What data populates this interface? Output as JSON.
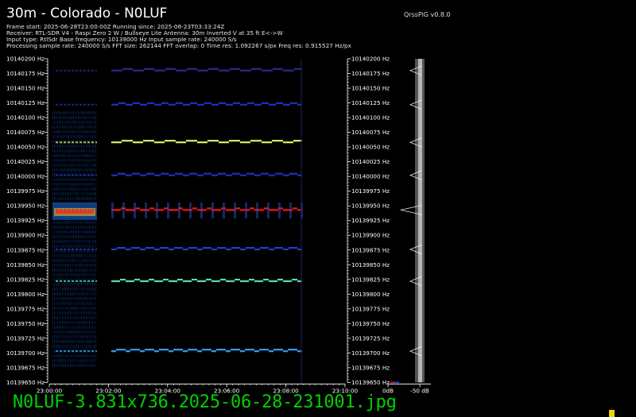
{
  "header": {
    "title": "30m - Colorado - N0LUF",
    "version": "QrssPiG v0.8.0",
    "info_lines": [
      "Frame start: 2025-06-28T23:00:00Z Running since: 2025-06-23T03:33:24Z",
      "Receiver: RTL-SDR V4 - Raspi Zero 2 W / Bullseye Lite Antenna: 30m Inverted V at 35 ft E<->W",
      "Input type: RtlSdr Base frequency: 10139000 Hz Input sample rate: 240000 S/s",
      "Processing sample rate: 240000 S/s FFT size: 262144 FFT overlap: 0 Time res: 1.092267 s/px Freq res: 0.915527 Hz/px"
    ]
  },
  "frequency_axis": {
    "labels": [
      "10140200 Hz",
      "10140175 Hz",
      "10140150 Hz",
      "10140125 Hz",
      "10140100 Hz",
      "10140075 Hz",
      "10140050 Hz",
      "10140025 Hz",
      "10140000 Hz",
      "10139975 Hz",
      "10139950 Hz",
      "10139925 Hz",
      "10139900 Hz",
      "10139875 Hz",
      "10139850 Hz",
      "10139825 Hz",
      "10139800 Hz",
      "10139775 Hz",
      "10139750 Hz",
      "10139725 Hz",
      "10139700 Hz",
      "10139675 Hz",
      "10139650 Hz"
    ]
  },
  "time_axis": {
    "labels": [
      "23:00:00",
      "23:02:00",
      "23:04:00",
      "23:06:00",
      "23:08:00",
      "23:10:00"
    ]
  },
  "spectrum_axis": {
    "labels": [
      "0dB",
      "-50 dB"
    ]
  },
  "signals": [
    {
      "freq_hz": 10140180,
      "color": "#2a2a90"
    },
    {
      "freq_hz": 10140122,
      "color": "#2030c0"
    },
    {
      "freq_hz": 10140058,
      "color": "#d8f060"
    },
    {
      "freq_hz": 10140002,
      "color": "#2030c0"
    },
    {
      "freq_hz": 10139943,
      "color": "#ff1010"
    },
    {
      "freq_hz": 10139876,
      "color": "#2040d0"
    },
    {
      "freq_hz": 10139822,
      "color": "#50e0b0"
    },
    {
      "freq_hz": 10139703,
      "color": "#30a0f0"
    }
  ],
  "footer": {
    "filename": "N0LUF-3.831x736.2025-06-28-231001.jpg"
  }
}
